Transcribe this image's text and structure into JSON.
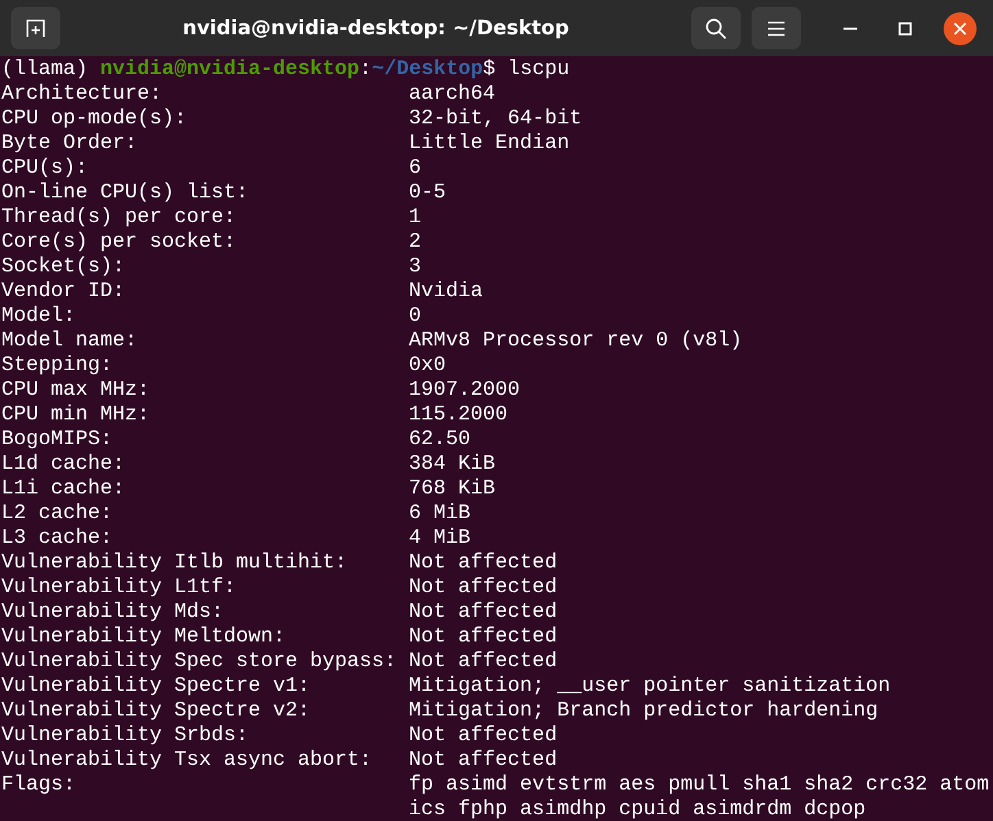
{
  "window": {
    "title": "nvidia@nvidia-desktop: ~/Desktop"
  },
  "prompt": {
    "env": "(llama) ",
    "user_host": "nvidia@nvidia-desktop",
    "separator": ":",
    "path": "~/Desktop",
    "symbol": "$ ",
    "command": "lscpu"
  },
  "output": [
    {
      "label": "Architecture:",
      "value": "aarch64"
    },
    {
      "label": "CPU op-mode(s):",
      "value": "32-bit, 64-bit"
    },
    {
      "label": "Byte Order:",
      "value": "Little Endian"
    },
    {
      "label": "CPU(s):",
      "value": "6"
    },
    {
      "label": "On-line CPU(s) list:",
      "value": "0-5"
    },
    {
      "label": "Thread(s) per core:",
      "value": "1"
    },
    {
      "label": "Core(s) per socket:",
      "value": "2"
    },
    {
      "label": "Socket(s):",
      "value": "3"
    },
    {
      "label": "Vendor ID:",
      "value": "Nvidia"
    },
    {
      "label": "Model:",
      "value": "0"
    },
    {
      "label": "Model name:",
      "value": "ARMv8 Processor rev 0 (v8l)"
    },
    {
      "label": "Stepping:",
      "value": "0x0"
    },
    {
      "label": "CPU max MHz:",
      "value": "1907.2000"
    },
    {
      "label": "CPU min MHz:",
      "value": "115.2000"
    },
    {
      "label": "BogoMIPS:",
      "value": "62.50"
    },
    {
      "label": "L1d cache:",
      "value": "384 KiB"
    },
    {
      "label": "L1i cache:",
      "value": "768 KiB"
    },
    {
      "label": "L2 cache:",
      "value": "6 MiB"
    },
    {
      "label": "L3 cache:",
      "value": "4 MiB"
    },
    {
      "label": "Vulnerability Itlb multihit:",
      "value": "Not affected"
    },
    {
      "label": "Vulnerability L1tf:",
      "value": "Not affected"
    },
    {
      "label": "Vulnerability Mds:",
      "value": "Not affected"
    },
    {
      "label": "Vulnerability Meltdown:",
      "value": "Not affected"
    },
    {
      "label": "Vulnerability Spec store bypass:",
      "value": "Not affected"
    },
    {
      "label": "Vulnerability Spectre v1:",
      "value": "Mitigation; __user pointer sanitization"
    },
    {
      "label": "Vulnerability Spectre v2:",
      "value": "Mitigation; Branch predictor hardening"
    },
    {
      "label": "Vulnerability Srbds:",
      "value": "Not affected"
    },
    {
      "label": "Vulnerability Tsx async abort:",
      "value": "Not affected"
    },
    {
      "label": "Flags:",
      "value": "fp asimd evtstrm aes pmull sha1 sha2 crc32 atomics fphp asimdhp cpuid asimdrdm dcpop"
    }
  ]
}
